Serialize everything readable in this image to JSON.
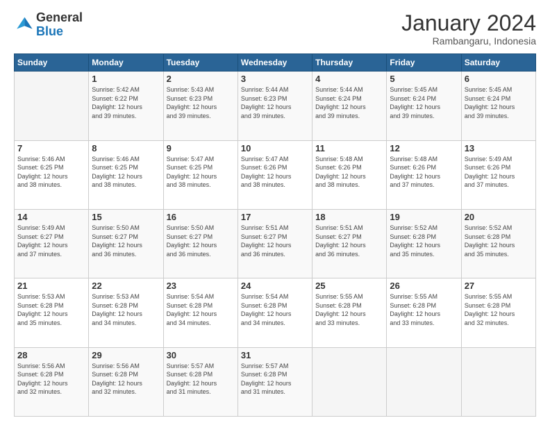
{
  "header": {
    "logo_general": "General",
    "logo_blue": "Blue",
    "month_title": "January 2024",
    "subtitle": "Rambangaru, Indonesia"
  },
  "weekdays": [
    "Sunday",
    "Monday",
    "Tuesday",
    "Wednesday",
    "Thursday",
    "Friday",
    "Saturday"
  ],
  "weeks": [
    [
      {
        "day": "",
        "info": ""
      },
      {
        "day": "1",
        "info": "Sunrise: 5:42 AM\nSunset: 6:22 PM\nDaylight: 12 hours\nand 39 minutes."
      },
      {
        "day": "2",
        "info": "Sunrise: 5:43 AM\nSunset: 6:23 PM\nDaylight: 12 hours\nand 39 minutes."
      },
      {
        "day": "3",
        "info": "Sunrise: 5:44 AM\nSunset: 6:23 PM\nDaylight: 12 hours\nand 39 minutes."
      },
      {
        "day": "4",
        "info": "Sunrise: 5:44 AM\nSunset: 6:24 PM\nDaylight: 12 hours\nand 39 minutes."
      },
      {
        "day": "5",
        "info": "Sunrise: 5:45 AM\nSunset: 6:24 PM\nDaylight: 12 hours\nand 39 minutes."
      },
      {
        "day": "6",
        "info": "Sunrise: 5:45 AM\nSunset: 6:24 PM\nDaylight: 12 hours\nand 39 minutes."
      }
    ],
    [
      {
        "day": "7",
        "info": "Sunrise: 5:46 AM\nSunset: 6:25 PM\nDaylight: 12 hours\nand 38 minutes."
      },
      {
        "day": "8",
        "info": "Sunrise: 5:46 AM\nSunset: 6:25 PM\nDaylight: 12 hours\nand 38 minutes."
      },
      {
        "day": "9",
        "info": "Sunrise: 5:47 AM\nSunset: 6:25 PM\nDaylight: 12 hours\nand 38 minutes."
      },
      {
        "day": "10",
        "info": "Sunrise: 5:47 AM\nSunset: 6:26 PM\nDaylight: 12 hours\nand 38 minutes."
      },
      {
        "day": "11",
        "info": "Sunrise: 5:48 AM\nSunset: 6:26 PM\nDaylight: 12 hours\nand 38 minutes."
      },
      {
        "day": "12",
        "info": "Sunrise: 5:48 AM\nSunset: 6:26 PM\nDaylight: 12 hours\nand 37 minutes."
      },
      {
        "day": "13",
        "info": "Sunrise: 5:49 AM\nSunset: 6:26 PM\nDaylight: 12 hours\nand 37 minutes."
      }
    ],
    [
      {
        "day": "14",
        "info": "Sunrise: 5:49 AM\nSunset: 6:27 PM\nDaylight: 12 hours\nand 37 minutes."
      },
      {
        "day": "15",
        "info": "Sunrise: 5:50 AM\nSunset: 6:27 PM\nDaylight: 12 hours\nand 36 minutes."
      },
      {
        "day": "16",
        "info": "Sunrise: 5:50 AM\nSunset: 6:27 PM\nDaylight: 12 hours\nand 36 minutes."
      },
      {
        "day": "17",
        "info": "Sunrise: 5:51 AM\nSunset: 6:27 PM\nDaylight: 12 hours\nand 36 minutes."
      },
      {
        "day": "18",
        "info": "Sunrise: 5:51 AM\nSunset: 6:27 PM\nDaylight: 12 hours\nand 36 minutes."
      },
      {
        "day": "19",
        "info": "Sunrise: 5:52 AM\nSunset: 6:28 PM\nDaylight: 12 hours\nand 35 minutes."
      },
      {
        "day": "20",
        "info": "Sunrise: 5:52 AM\nSunset: 6:28 PM\nDaylight: 12 hours\nand 35 minutes."
      }
    ],
    [
      {
        "day": "21",
        "info": "Sunrise: 5:53 AM\nSunset: 6:28 PM\nDaylight: 12 hours\nand 35 minutes."
      },
      {
        "day": "22",
        "info": "Sunrise: 5:53 AM\nSunset: 6:28 PM\nDaylight: 12 hours\nand 34 minutes."
      },
      {
        "day": "23",
        "info": "Sunrise: 5:54 AM\nSunset: 6:28 PM\nDaylight: 12 hours\nand 34 minutes."
      },
      {
        "day": "24",
        "info": "Sunrise: 5:54 AM\nSunset: 6:28 PM\nDaylight: 12 hours\nand 34 minutes."
      },
      {
        "day": "25",
        "info": "Sunrise: 5:55 AM\nSunset: 6:28 PM\nDaylight: 12 hours\nand 33 minutes."
      },
      {
        "day": "26",
        "info": "Sunrise: 5:55 AM\nSunset: 6:28 PM\nDaylight: 12 hours\nand 33 minutes."
      },
      {
        "day": "27",
        "info": "Sunrise: 5:55 AM\nSunset: 6:28 PM\nDaylight: 12 hours\nand 32 minutes."
      }
    ],
    [
      {
        "day": "28",
        "info": "Sunrise: 5:56 AM\nSunset: 6:28 PM\nDaylight: 12 hours\nand 32 minutes."
      },
      {
        "day": "29",
        "info": "Sunrise: 5:56 AM\nSunset: 6:28 PM\nDaylight: 12 hours\nand 32 minutes."
      },
      {
        "day": "30",
        "info": "Sunrise: 5:57 AM\nSunset: 6:28 PM\nDaylight: 12 hours\nand 31 minutes."
      },
      {
        "day": "31",
        "info": "Sunrise: 5:57 AM\nSunset: 6:28 PM\nDaylight: 12 hours\nand 31 minutes."
      },
      {
        "day": "",
        "info": ""
      },
      {
        "day": "",
        "info": ""
      },
      {
        "day": "",
        "info": ""
      }
    ]
  ]
}
